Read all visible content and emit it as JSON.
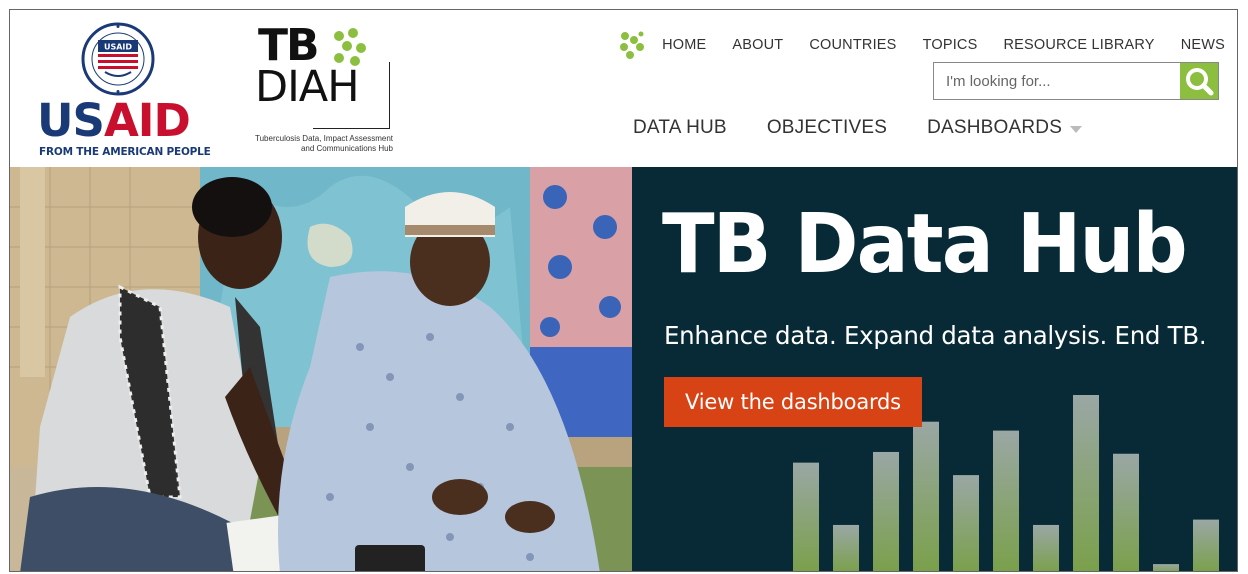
{
  "usaid": {
    "wordmark_us": "US",
    "wordmark_aid": "AID",
    "tagline": "FROM THE AMERICAN PEOPLE",
    "seal_text": "USAID",
    "colors": {
      "navy": "#1a3a77",
      "red": "#c8102e"
    }
  },
  "tbdiah": {
    "tb": "TB",
    "diah": "DIAH",
    "subtitle_line1": "Tuberculosis Data, Impact Assessment",
    "subtitle_line2": "and Communications Hub",
    "accent": "#8cbf3f"
  },
  "topnav": {
    "icon": "tbdiah-dots-icon",
    "items": [
      "HOME",
      "ABOUT",
      "COUNTRIES",
      "TOPICS",
      "RESOURCE LIBRARY",
      "NEWS"
    ]
  },
  "search": {
    "placeholder": "I'm looking for...",
    "value": "",
    "button_icon": "search-icon",
    "button_color": "#8cbf3f"
  },
  "mainnav": {
    "items": [
      "DATA HUB",
      "OBJECTIVES",
      "DASHBOARDS"
    ],
    "dropdown_icon": "caret-down-icon"
  },
  "hero": {
    "title": "TB Data Hub",
    "tagline": "Enhance data. Expand data analysis. End TB.",
    "cta_label": "View the dashboards",
    "panel_color": "#072a36",
    "cta_color": "#d84315",
    "decor_bar_levels": [
      0.62,
      0.27,
      0.68,
      0.85,
      0.55,
      0.8,
      0.27,
      1.0,
      0.67,
      0.05,
      0.3
    ]
  }
}
